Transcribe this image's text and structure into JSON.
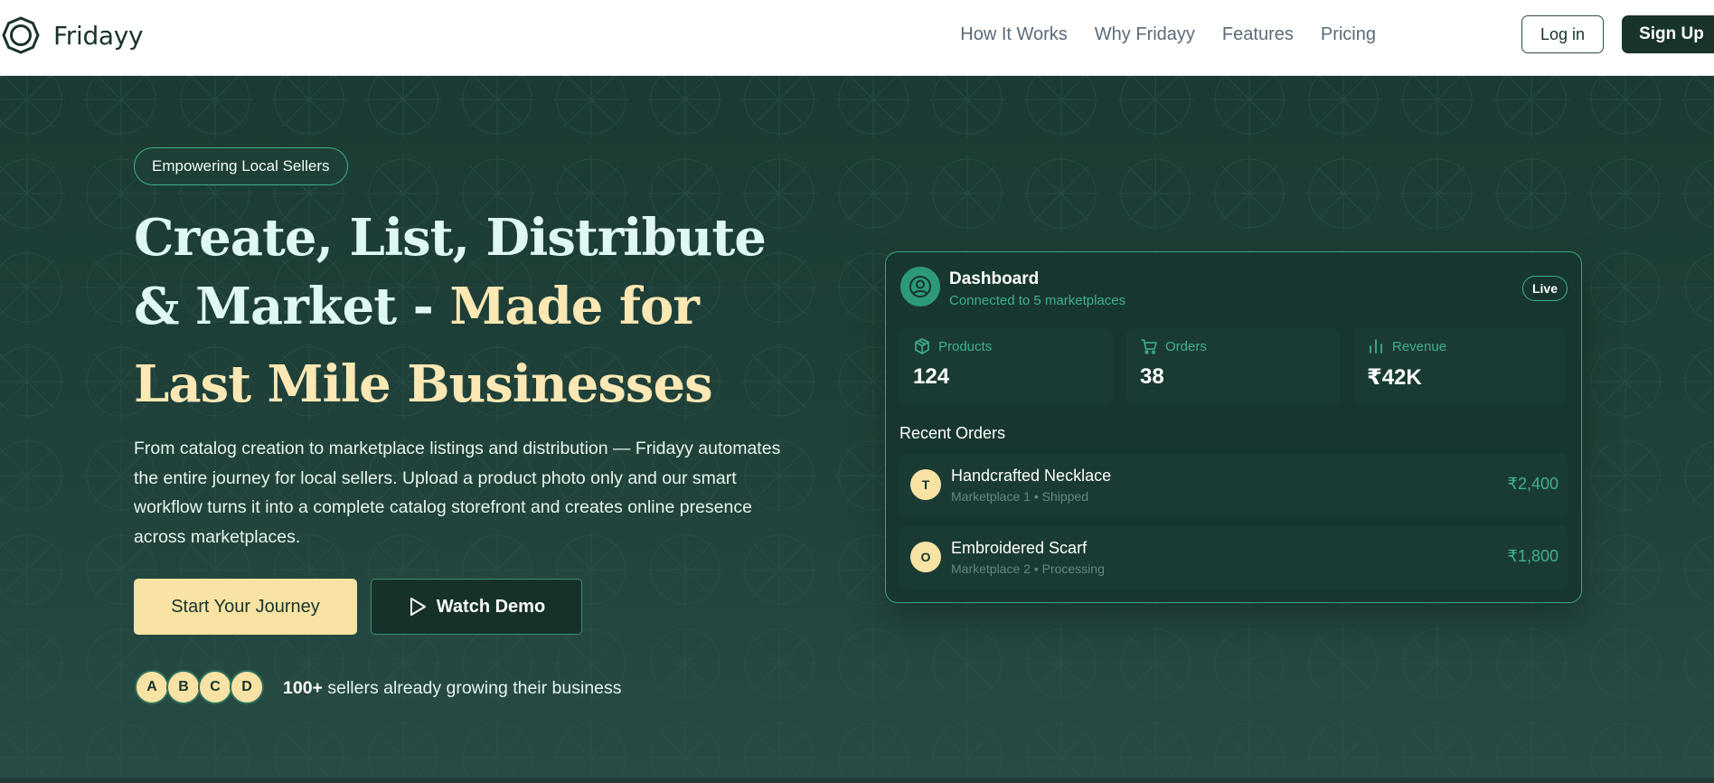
{
  "brand": {
    "name": "Fridayy"
  },
  "nav": {
    "links": [
      "How It Works",
      "Why Fridayy",
      "Features",
      "Pricing"
    ],
    "login_label": "Log in",
    "signup_label": "Sign Up"
  },
  "hero": {
    "badge": "Empowering Local Sellers",
    "headline_line1": "Create, List, Distribute",
    "headline_line2_part1": "& Market - ",
    "headline_line2_part2": "Made for",
    "headline_line3": "Last Mile Businesses",
    "description": "From catalog creation to marketplace listings and distribution — Fridayy automates the entire journey for local sellers. Upload a product photo only and our smart workflow turns it into a complete catalog storefront and creates online presence across marketplaces.",
    "primary_cta": "Start Your Journey",
    "secondary_cta": "Watch Demo",
    "avatars": [
      "A",
      "B",
      "C",
      "D"
    ],
    "social_count": "100+",
    "social_text": " sellers already growing their business"
  },
  "dashboard": {
    "title": "Dashboard",
    "subtitle": "Connected to 5 marketplaces",
    "status": "Live",
    "stats": [
      {
        "label": "Products",
        "value": "124",
        "icon": "box-icon"
      },
      {
        "label": "Orders",
        "value": "38",
        "icon": "cart-icon"
      },
      {
        "label": "Revenue",
        "value": "₹42K",
        "icon": "bar-chart-icon"
      }
    ],
    "recent_title": "Recent Orders",
    "orders": [
      {
        "initial": "T",
        "name": "Handcrafted Necklace",
        "meta": "Marketplace 1 • Shipped",
        "amount": "₹2,400"
      },
      {
        "initial": "O",
        "name": "Embroidered Scarf",
        "meta": "Marketplace 2 • Processing",
        "amount": "₹1,800"
      }
    ]
  },
  "colors": {
    "dark_green": "#17332c",
    "hero_bg": "#1b3a33",
    "accent_green": "#3eb08c",
    "cream": "#fbe8b4",
    "mint": "#dff8f3"
  }
}
